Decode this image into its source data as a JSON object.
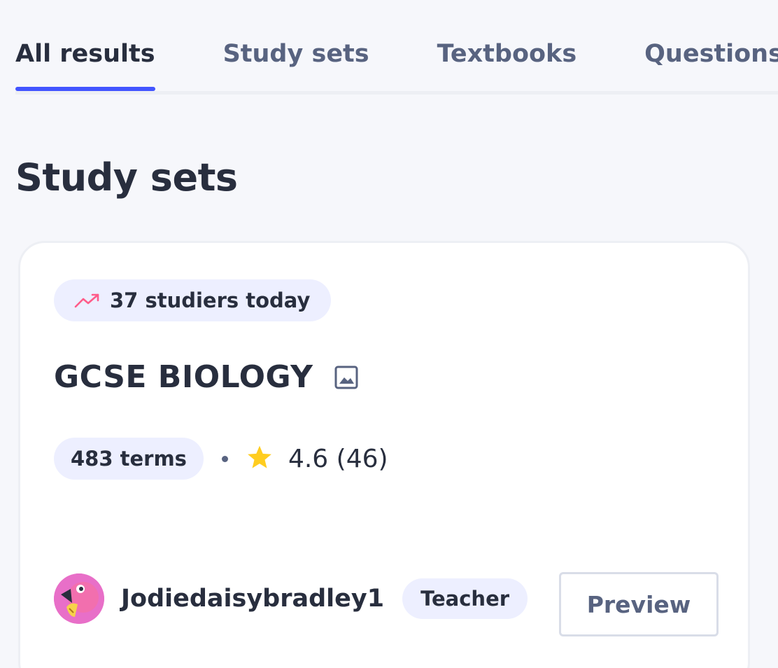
{
  "tabs": [
    {
      "label": "All results",
      "active": true
    },
    {
      "label": "Study sets",
      "active": false
    },
    {
      "label": "Textbooks",
      "active": false
    },
    {
      "label": "Questions",
      "active": false
    }
  ],
  "section": {
    "title": "Study sets"
  },
  "card": {
    "studiers_badge": {
      "icon": "trending-up-icon",
      "text": "37 studiers today"
    },
    "title": "GCSE BIOLOGY",
    "title_icon": "image-icon",
    "terms": "483 terms",
    "rating_icon": "star-icon",
    "rating": "4.6 (46)",
    "creator": {
      "avatar": "flamingo-avatar",
      "username": "Jodiedaisybradley1",
      "role": "Teacher"
    },
    "preview_label": "Preview"
  },
  "colors": {
    "accent": "#4255ff",
    "background": "#f6f7fb",
    "pill": "#edefff",
    "star": "#ffcd1f",
    "trend": "#ff5c8a"
  }
}
